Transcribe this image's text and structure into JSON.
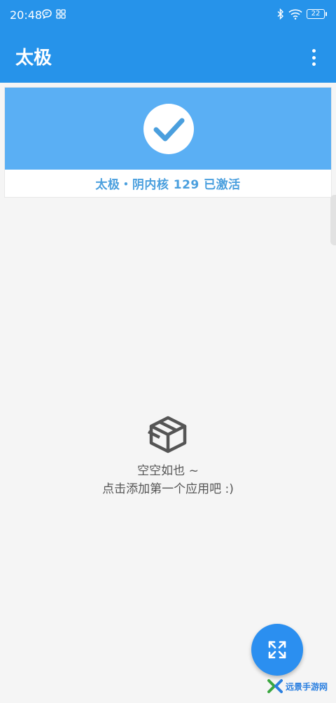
{
  "status_bar": {
    "time": "20:48",
    "battery": "22",
    "icons": [
      "chat-bubble-icon",
      "grid-icon",
      "bluetooth-icon",
      "wifi-icon",
      "battery-icon"
    ]
  },
  "app_bar": {
    "title": "太极",
    "menu_icon": "more-vert-icon"
  },
  "status_card": {
    "icon": "check-icon",
    "text": "太极・阴内核 129 已激活"
  },
  "empty_state": {
    "icon": "box-icon",
    "title": "空空如也 ~",
    "subtitle": "点击添加第一个应用吧 :)"
  },
  "fab": {
    "icon": "expand-icon"
  },
  "watermark": {
    "text": "远景手游网"
  },
  "colors": {
    "primary": "#2693ea",
    "card_header": "#5aaff4",
    "status_text": "#4a9fde",
    "fab": "#2b8ff0"
  }
}
